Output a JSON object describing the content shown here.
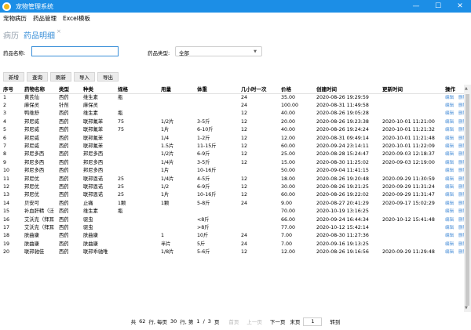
{
  "window": {
    "title": "宠物管理系统",
    "minimize": "—",
    "maximize": "☐",
    "close": "✕"
  },
  "menu": [
    "宠物病历",
    "药品管理",
    "Excel模板"
  ],
  "tabs": [
    {
      "label": "病历"
    },
    {
      "label": "药品明细"
    }
  ],
  "tab_close": "×",
  "search": {
    "name_label": "药品名称:",
    "name_value": "",
    "type_label": "药品类型:",
    "type_value": "全部"
  },
  "toolbar": [
    "新增",
    "查询",
    "刷新",
    "导入",
    "导出"
  ],
  "table": {
    "columns": [
      "序号",
      "药物名称",
      "类型",
      "种类",
      "规格",
      "用量",
      "体重",
      "几小时一次",
      "价格",
      "创建时间",
      "更新时间",
      "操作"
    ],
    "op_edit": "编辑",
    "op_delete": "删除",
    "rows": [
      [
        "1",
        "黄芪仙",
        "西药",
        "维生素",
        "瓶",
        "",
        "",
        "24",
        "35.00",
        "2020-08-26 19:29:59",
        ""
      ],
      [
        "2",
        "麻保灵",
        "针剂",
        "麻保灵",
        "",
        "",
        "",
        "24",
        "100.00",
        "2020-08-31 11:49:58",
        ""
      ],
      [
        "3",
        "鸭维舒",
        "西药",
        "维生素",
        "瓶",
        "",
        "",
        "12",
        "40.00",
        "2020-08-26 19:05:28",
        ""
      ],
      [
        "4",
        "邦尼威",
        "西药",
        "联邦氟苯",
        "75",
        "1/2片",
        "3-5斤",
        "12",
        "20.00",
        "2020-08-26 19:23:38",
        "2020-10-01 11:21:00"
      ],
      [
        "5",
        "邦尼威",
        "西药",
        "联邦氟苯",
        "75",
        "1片",
        "6-10斤",
        "12",
        "40.00",
        "2020-08-26 19:24:24",
        "2020-10-01 11:21:32"
      ],
      [
        "6",
        "邦尼威",
        "西药",
        "联邦氟苯",
        "",
        "1/4",
        "1-2斤",
        "12",
        "12.00",
        "2020-08-31 09:49:14",
        "2020-10-01 11:21:48"
      ],
      [
        "7",
        "邦尼威",
        "西药",
        "联邦氟苯",
        "",
        "1.5片",
        "11-15斤",
        "12",
        "60.00",
        "2020-09-24 23:14:11",
        "2020-10-01 11:22:09"
      ],
      [
        "8",
        "邦尼多西",
        "西药",
        "邦尼多西",
        "",
        "1/2片",
        "6-9斤",
        "12",
        "25.00",
        "2020-08-28 15:24:47",
        "2020-09-03 12:18:37"
      ],
      [
        "9",
        "邦尼多西",
        "西药",
        "邦尼多西",
        "",
        "1/4片",
        "3-5斤",
        "12",
        "15.00",
        "2020-08-30 11:25:02",
        "2020-09-03 12:19:00"
      ],
      [
        "10",
        "邦尼多西",
        "西药",
        "邦尼多西",
        "",
        "1片",
        "10-16斤",
        "",
        "50.00",
        "2020-09-04 11:41:15",
        ""
      ],
      [
        "11",
        "邦尼优",
        "西药",
        "联邦恩诺",
        "25",
        "1/4片",
        "4-5斤",
        "12",
        "18.00",
        "2020-08-26 19:20:48",
        "2020-09-29 11:30:59"
      ],
      [
        "12",
        "邦尼优",
        "西药",
        "联邦恩诺",
        "25",
        "1/2",
        "6-9斤",
        "12",
        "30.00",
        "2020-08-26 19:21:25",
        "2020-09-29 11:31:24"
      ],
      [
        "13",
        "邦尼优",
        "西药",
        "联邦恩诺",
        "25",
        "1片",
        "10-16斤",
        "12",
        "60.00",
        "2020-08-26 19:22:02",
        "2020-09-29 11:31:47"
      ],
      [
        "14",
        "贝安可",
        "西药",
        "止痛",
        "1颗",
        "1颗",
        "5-8斤",
        "24",
        "9.00",
        "2020-08-27 20:41:29",
        "2020-09-17 15:02:29"
      ],
      [
        "15",
        "补血肝精（泛",
        "西药",
        "维生素",
        "瓶",
        "",
        "",
        "",
        "70.00",
        "2020-10-19 13:16:25",
        ""
      ],
      [
        "16",
        "艾沃克（拜耳",
        "西药",
        "驱虫",
        "",
        "",
        "<8斤",
        "",
        "66.00",
        "2020-09-24 16:44:34",
        "2020-10-12 15:41:48"
      ],
      [
        "17",
        "艾沃克（拜耳",
        "西药",
        "驱虫",
        "",
        "",
        ">8斤",
        "",
        "77.00",
        "2020-10-12 15:42:14",
        ""
      ],
      [
        "18",
        "肤曲康",
        "西药",
        "肤曲康",
        "",
        "1",
        "10斤",
        "24",
        "7.00",
        "2020-08-30 11:27:36",
        ""
      ],
      [
        "19",
        "肤曲康",
        "西药",
        "肤曲康",
        "",
        "半片",
        "5斤",
        "24",
        "7.00",
        "2020-09-16 19:13:25",
        ""
      ],
      [
        "20",
        "联邦驰佳",
        "西药",
        "联邦乖驰唯",
        "",
        "1/8片",
        "5-6斤",
        "12",
        "12.00",
        "2020-08-26 19:16:56",
        "2020-09-29 11:29:48"
      ]
    ]
  },
  "pager": {
    "total_prefix": "共",
    "total": "62",
    "total_unit": "行, 每页",
    "per_page": "30",
    "per_page_unit": "行, 第",
    "current": "1",
    "sep": "/",
    "pages": "3",
    "pages_unit": "页",
    "first": "首页",
    "prev": "上一页",
    "next": "下一页",
    "last": "末页",
    "goto_value": "1",
    "goto": "转到"
  }
}
